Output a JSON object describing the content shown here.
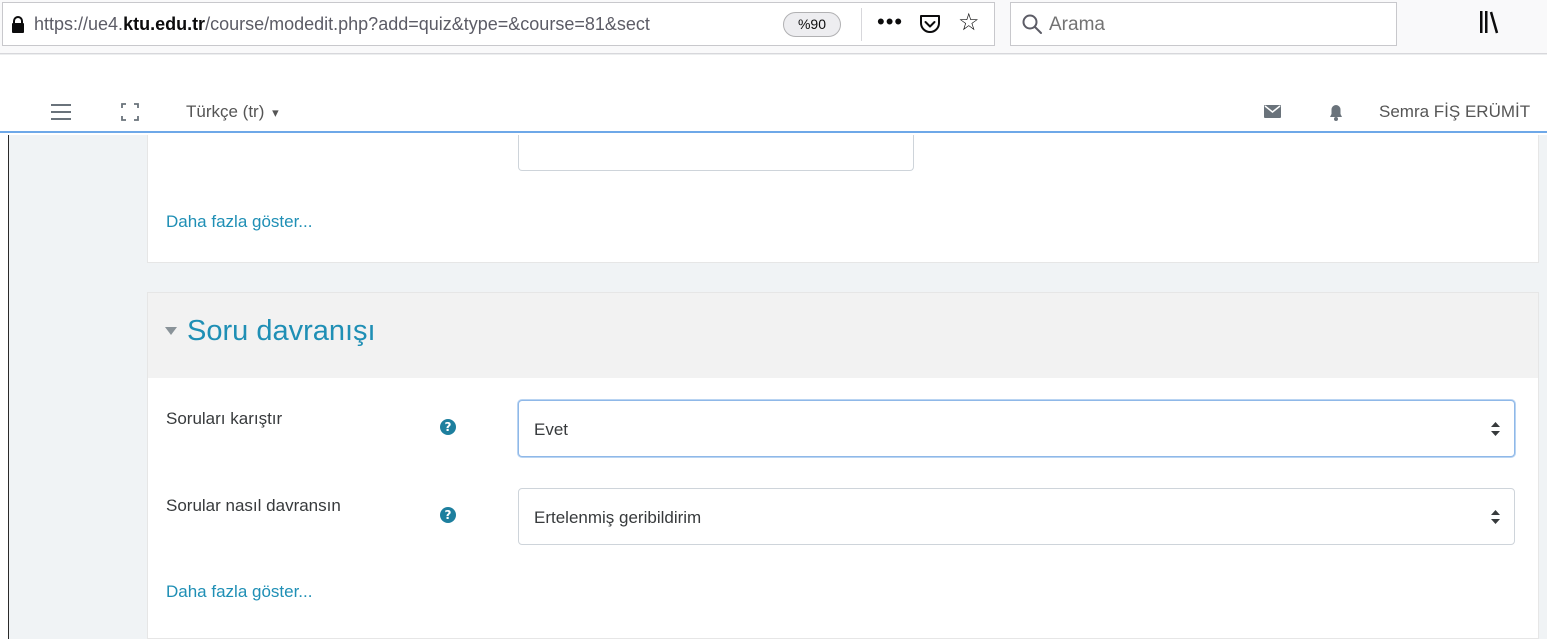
{
  "browser": {
    "url_prefix": "https://ue4.",
    "url_domain": "ktu.edu.tr",
    "url_path": "/course/modedit.php?add=quiz&type=&course=81&sect",
    "zoom": "%90",
    "search_placeholder": "Arama",
    "icons": [
      "lock-icon",
      "more-actions-icon",
      "pocket-icon",
      "bookmark-star-icon",
      "search-icon",
      "library-icon"
    ]
  },
  "navbar": {
    "language": "Türkçe (tr)",
    "language_caret": "▾",
    "user_name": "Semra FİŞ ERÜMİT",
    "icons": [
      "hamburger-icon",
      "fullscreen-icon",
      "mail-icon",
      "bell-icon"
    ]
  },
  "previous_section": {
    "more_link": "Daha fazla göster..."
  },
  "question_behaviour": {
    "legend": "Soru davranışı",
    "fields": [
      {
        "label": "Soruları karıştır",
        "help": "?",
        "value": "Evet"
      },
      {
        "label": "Sorular nasıl davransın",
        "help": "?",
        "value": "Ertelenmiş geribildirim"
      }
    ],
    "more_link": "Daha fazla göster..."
  },
  "colors": {
    "link": "#1f8fb5",
    "help_icon": "#1d7f9e",
    "navbar_border": "#6ea8e8",
    "page_background": "#f0f3f5"
  }
}
